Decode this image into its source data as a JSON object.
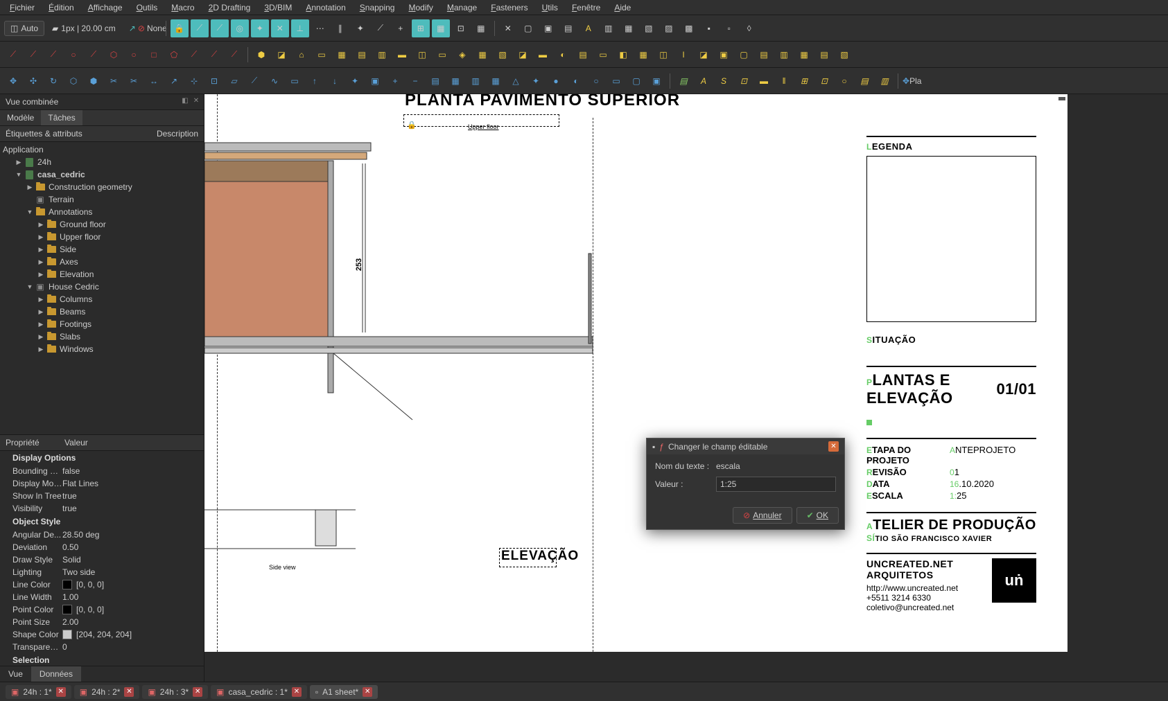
{
  "menu": [
    "Fichier",
    "Édition",
    "Affichage",
    "Outils",
    "Macro",
    "2D Drafting",
    "3D/BIM",
    "Annotation",
    "Snapping",
    "Modify",
    "Manage",
    "Fasteners",
    "Utils",
    "Fenêtre",
    "Aide"
  ],
  "auto_label": "Auto",
  "px_label": "1px | 20.00 cm",
  "none_label": "None",
  "pla_label": "Pla",
  "panel_title": "Vue combinée",
  "tabs": {
    "model": "Modèle",
    "tasks": "Tâches"
  },
  "tree_headers": {
    "labels": "Étiquettes & attributs",
    "desc": "Description"
  },
  "tree": {
    "app": "Application",
    "items": [
      {
        "l": "24h",
        "indent": 1,
        "arrow": "▶",
        "icon": "doc"
      },
      {
        "l": "casa_cedric",
        "indent": 1,
        "arrow": "▼",
        "icon": "doc",
        "bold": true
      },
      {
        "l": "Construction geometry",
        "indent": 2,
        "arrow": "▶",
        "icon": "folder",
        "dim": true
      },
      {
        "l": "Terrain",
        "indent": 2,
        "arrow": "",
        "icon": "terrain",
        "dim": true
      },
      {
        "l": "Annotations",
        "indent": 2,
        "arrow": "▼",
        "icon": "folder"
      },
      {
        "l": "Ground floor",
        "indent": 3,
        "arrow": "▶",
        "icon": "folder"
      },
      {
        "l": "Upper floor",
        "indent": 3,
        "arrow": "▶",
        "icon": "folder"
      },
      {
        "l": "Side",
        "indent": 3,
        "arrow": "▶",
        "icon": "folder"
      },
      {
        "l": "Axes",
        "indent": 3,
        "arrow": "▶",
        "icon": "folder"
      },
      {
        "l": "Elevation",
        "indent": 3,
        "arrow": "▶",
        "icon": "folder"
      },
      {
        "l": "House Cedric",
        "indent": 2,
        "arrow": "▼",
        "icon": "house"
      },
      {
        "l": "Columns",
        "indent": 3,
        "arrow": "▶",
        "icon": "folder"
      },
      {
        "l": "Beams",
        "indent": 3,
        "arrow": "▶",
        "icon": "folder"
      },
      {
        "l": "Footings",
        "indent": 3,
        "arrow": "▶",
        "icon": "folder"
      },
      {
        "l": "Slabs",
        "indent": 3,
        "arrow": "▶",
        "icon": "folder"
      },
      {
        "l": "Windows",
        "indent": 3,
        "arrow": "▶",
        "icon": "folder"
      }
    ]
  },
  "prop_headers": {
    "prop": "Propriété",
    "val": "Valeur"
  },
  "props": [
    {
      "group": "Display Options"
    },
    {
      "k": "Bounding B...",
      "v": "false"
    },
    {
      "k": "Display Mode",
      "v": "Flat Lines"
    },
    {
      "k": "Show In Tree",
      "v": "true"
    },
    {
      "k": "Visibility",
      "v": "true"
    },
    {
      "group": "Object Style"
    },
    {
      "k": "Angular De...",
      "v": "28.50 deg"
    },
    {
      "k": "Deviation",
      "v": "0.50"
    },
    {
      "k": "Draw Style",
      "v": "Solid"
    },
    {
      "k": "Lighting",
      "v": "Two side"
    },
    {
      "k": "Line Color",
      "v": "[0, 0, 0]",
      "color": "#000"
    },
    {
      "k": "Line Width",
      "v": "1.00"
    },
    {
      "k": "Point Color",
      "v": "[0, 0, 0]",
      "color": "#000"
    },
    {
      "k": "Point Size",
      "v": "2.00"
    },
    {
      "k": "Shape Color",
      "v": "[204, 204, 204]",
      "color": "#ccc"
    },
    {
      "k": "Transparency",
      "v": "0"
    },
    {
      "group": "Selection"
    }
  ],
  "bottom_tabs": {
    "vue": "Vue",
    "data": "Données"
  },
  "drawing": {
    "title_upper": "PLANTA PAVIMENTO SUPERIOR",
    "upper_floor_label": "Upper floor",
    "dim_253": "253",
    "elevacao": "ELEVAÇÃO",
    "side_view": "Side view"
  },
  "titleblock": {
    "legenda": "LEGENDA",
    "situacao": "SITUAÇÃO",
    "plantas": "PLANTAS E ELEVAÇÃO",
    "page": "01/01",
    "etapa_k": "ETAPA DO PROJETO",
    "etapa_v": "ANTEPROJETO",
    "rev_k": "REVISÃO",
    "rev_v": "01",
    "data_k": "DATA",
    "data_v": "16.10.2020",
    "escala_k": "ESCALA",
    "escala_v": "1:25",
    "atelier": "ATELIER DE PRODUÇÃO",
    "sitio": "SÍTIO SÃO FRANCISCO XAVIER",
    "firm": "UNCREATED.NET ARQUITETOS",
    "url": "http://www.uncreated.net",
    "phone": "+5511 3214 6330",
    "email": "coletivo@uncreated.net"
  },
  "dialog": {
    "title": "Changer le champ éditable",
    "name_label": "Nom du texte :",
    "name_value": "escala",
    "value_label": "Valeur :",
    "value_value": "1:25",
    "cancel": "Annuler",
    "ok": "OK"
  },
  "doc_tabs": [
    "24h : 1*",
    "24h : 2*",
    "24h : 3*",
    "casa_cedric : 1*",
    "A1 sheet*"
  ]
}
